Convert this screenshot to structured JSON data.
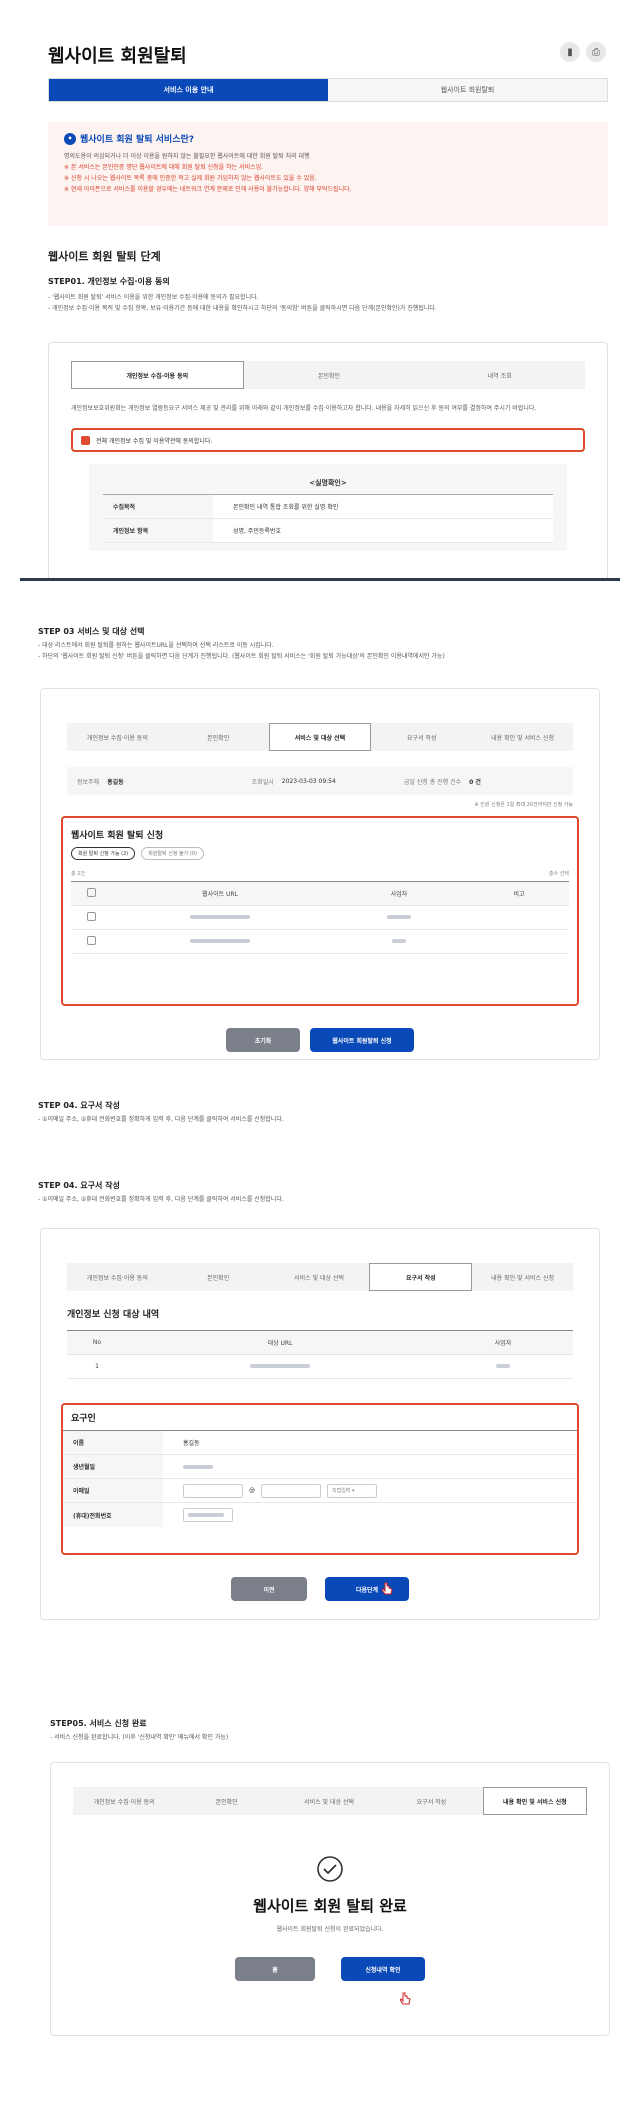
{
  "header": {
    "title": "웹사이트 회원탈퇴"
  },
  "tabs": [
    "서비스 이용 안내",
    "웹사이트 회원탈퇴"
  ],
  "info": {
    "title": "웹사이트 회원 탈퇴 서비스란?",
    "lines": [
      "명의도용이 의심되거나 더 이상 이용을 원하지 않는 불필요한 웹사이트에 대한 회원 탈퇴 처리 대행",
      "※ 본 서비스는 본인인증 명단 웹사이트에 대해 회원 탈퇴 신청을 하는 서비스임.",
      "※ 신청 시 나오는 웹사이트 목록 중에 인증한 적고 실제 회원 가입하지 않는 웹사이트도 있을 수 있음.",
      "※ 현재 아이폰으로 서비스를 이용할 경우에는 네트워크 연계 문제로 인해 사용이 불가능합니다. 양해 부탁드립니다."
    ]
  },
  "steps_title": "웹사이트 회원 탈퇴 단계",
  "step1": {
    "title": "STEP01. 개인정보 수집·이용 동의",
    "desc": [
      "- '웹사이트 회원 탈퇴' 서비스 이용을 위한 개인정보 수집·이용에 동의가 필요합니다.",
      "- 개인정보 수집·이용 목적 및 수집 항목, 보유·이용기간 등에 대한 내용을 확인하시고 하단의 '동의함' 버튼을 클릭하시면 다음 단계(본인확인)가 진행됩니다."
    ],
    "progress": [
      "개인정보 수집·이용 동의",
      "본인확인",
      "내역 조회"
    ],
    "body": "개인정보보호위원회는 개인정보 열람등요구 서비스 제공 및 관리를 위해 아래와 같이 개인정보를 수집·이용하고자 합니다. 내용을 자세히 읽으신 후 동의 여부를 결정하여 주시기 바랍니다.",
    "agree": "전체 개인정보 수집 및 이용약관에 동의합니다.",
    "table_title": "<실명확인>",
    "rows": [
      {
        "k": "수집목적",
        "v": "본인확인 내역 통합 조회를 위한 실명 확인"
      },
      {
        "k": "개인정보 항목",
        "v": "성명, 주민등록번호"
      }
    ]
  },
  "step3": {
    "title": "STEP 03 서비스 및 대상 선택",
    "desc": [
      "- 대상 리스트에서 회원 탈퇴를 원하는 웹사이트URL을 선택하여 선택 리스트로 이동 시킵니다.",
      "- 하단의 '웹사이트 회원 탈퇴 신청' 버튼을 클릭하면 다음 단계가 진행됩니다. (웹사이트 회원 탈퇴 서비스는 '회원 탈퇴 가능대상'의 본인확인 이용내역에서만 가능)"
    ],
    "progress": [
      "개인정보 수집·이용 동의",
      "본인확인",
      "서비스 및 대상 선택",
      "요구서 작성",
      "내용 확인 및 서비스 신청"
    ],
    "owner_label": "정보주체",
    "owner": "홍길동",
    "time_label": "조회일시",
    "time": "2023-03-03 09:54",
    "count_label": "금일 신청 총 진행 건수",
    "count": "0 건",
    "note": "※ 인원 신청은 1일 최대 20건까지만 신청 가능",
    "box_title": "웹사이트 회원 탈퇴 신청",
    "chip_on": "회원 탈퇴 신청 가능 (2)",
    "chip_off": "회원탈퇴 신청 불가 (0)",
    "total": "총 2건",
    "all_select": "총수 선택",
    "headers": [
      "",
      "웹사이트 URL",
      "사업자",
      "비고"
    ],
    "reset": "초기화",
    "submit": "웹사이트 회원탈퇴 신청"
  },
  "step4a": {
    "title": "STEP 04. 요구서 작성",
    "desc": "- ①이메일 주소, ②휴대 전화번호를 정확하게 입력 후, 다음 단계를 클릭하여 서비스를 신청합니다."
  },
  "step4": {
    "title": "STEP 04. 요구서 작성",
    "desc": "- ①이메일 주소, ②휴대 전화번호를 정확하게 입력 후, 다음 단계를 클릭하여 서비스를 신청합니다.",
    "progress": [
      "개인정보 수집·이용 동의",
      "본인확인",
      "서비스 및 대상 선택",
      "요구서 작성",
      "내용 확인 및 서비스 신청"
    ],
    "list_title": "개인정보 신청 대상 내역",
    "headers": [
      "No",
      "대상 URL",
      "사업자"
    ],
    "row_no": "1",
    "req_title": "요구인",
    "fields": [
      {
        "k": "이름",
        "v": "홍길동"
      },
      {
        "k": "생년월일",
        "v": ""
      },
      {
        "k": "이메일",
        "v": ""
      },
      {
        "k": "(휴대)전화번호",
        "v": ""
      }
    ],
    "email_at": "@",
    "email_select": "직접입력",
    "prev": "이전",
    "next": "다음단계"
  },
  "step5": {
    "title": "STEP05. 서비스 신청 완료",
    "desc": "- 서비스 신청을 완료합니다. (이후 '신청내역 확인' 메뉴에서 확인 가능)",
    "progress": [
      "개인정보 수집·이용 동의",
      "본인확인",
      "서비스 및 대상 선택",
      "요구서 작성",
      "내용 확인 및 서비스 신청"
    ],
    "done_title": "웹사이트 회원 탈퇴 완료",
    "done_sub": "웹사이트 회원탈퇴 신청이 완료되었습니다.",
    "home": "홈",
    "check": "신청내역 확인"
  },
  "colors": {
    "accent": "#0a49b8",
    "alert": "#e04a2f",
    "info_bg": "#fdf3f1"
  }
}
